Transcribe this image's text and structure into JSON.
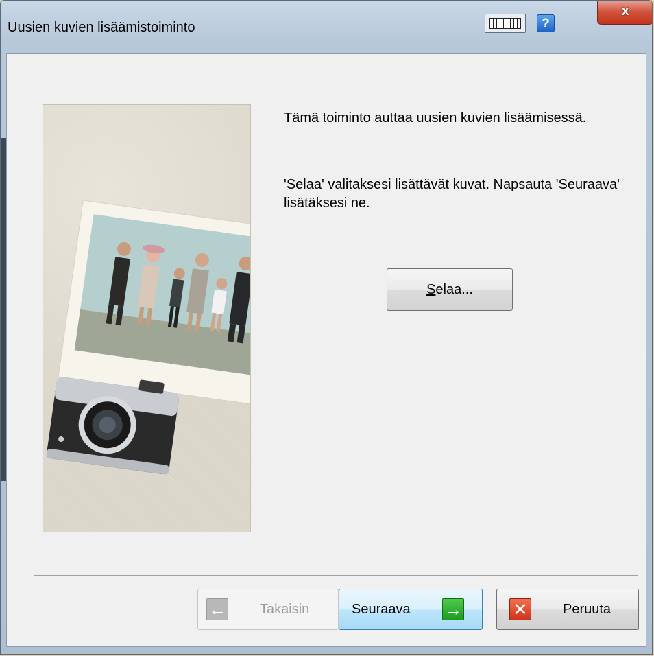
{
  "window": {
    "title": "Uusien kuvien lisäämistoiminto",
    "close_glyph": "x",
    "help_glyph": "?"
  },
  "content": {
    "intro": "Tämä toiminto auttaa uusien kuvien lisäämisessä.",
    "instructions": "'Selaa' valitaksesi lisättävät kuvat. Napsauta 'Seuraava' lisätäksesi ne.",
    "browse_label_first": "S",
    "browse_label_rest": "elaa..."
  },
  "footer": {
    "back_label": "Takaisin",
    "next_label": "Seuraava",
    "cancel_label": "Peruuta"
  },
  "icons": {
    "keyboard": "keyboard-icon",
    "help": "help-icon",
    "close": "close-icon",
    "back": "arrow-left-icon",
    "next": "arrow-right-icon",
    "cancel": "x-icon"
  },
  "colors": {
    "accent_next": "#3c7fb1",
    "close_red": "#c3341b",
    "next_green": "#1e9a1e"
  }
}
